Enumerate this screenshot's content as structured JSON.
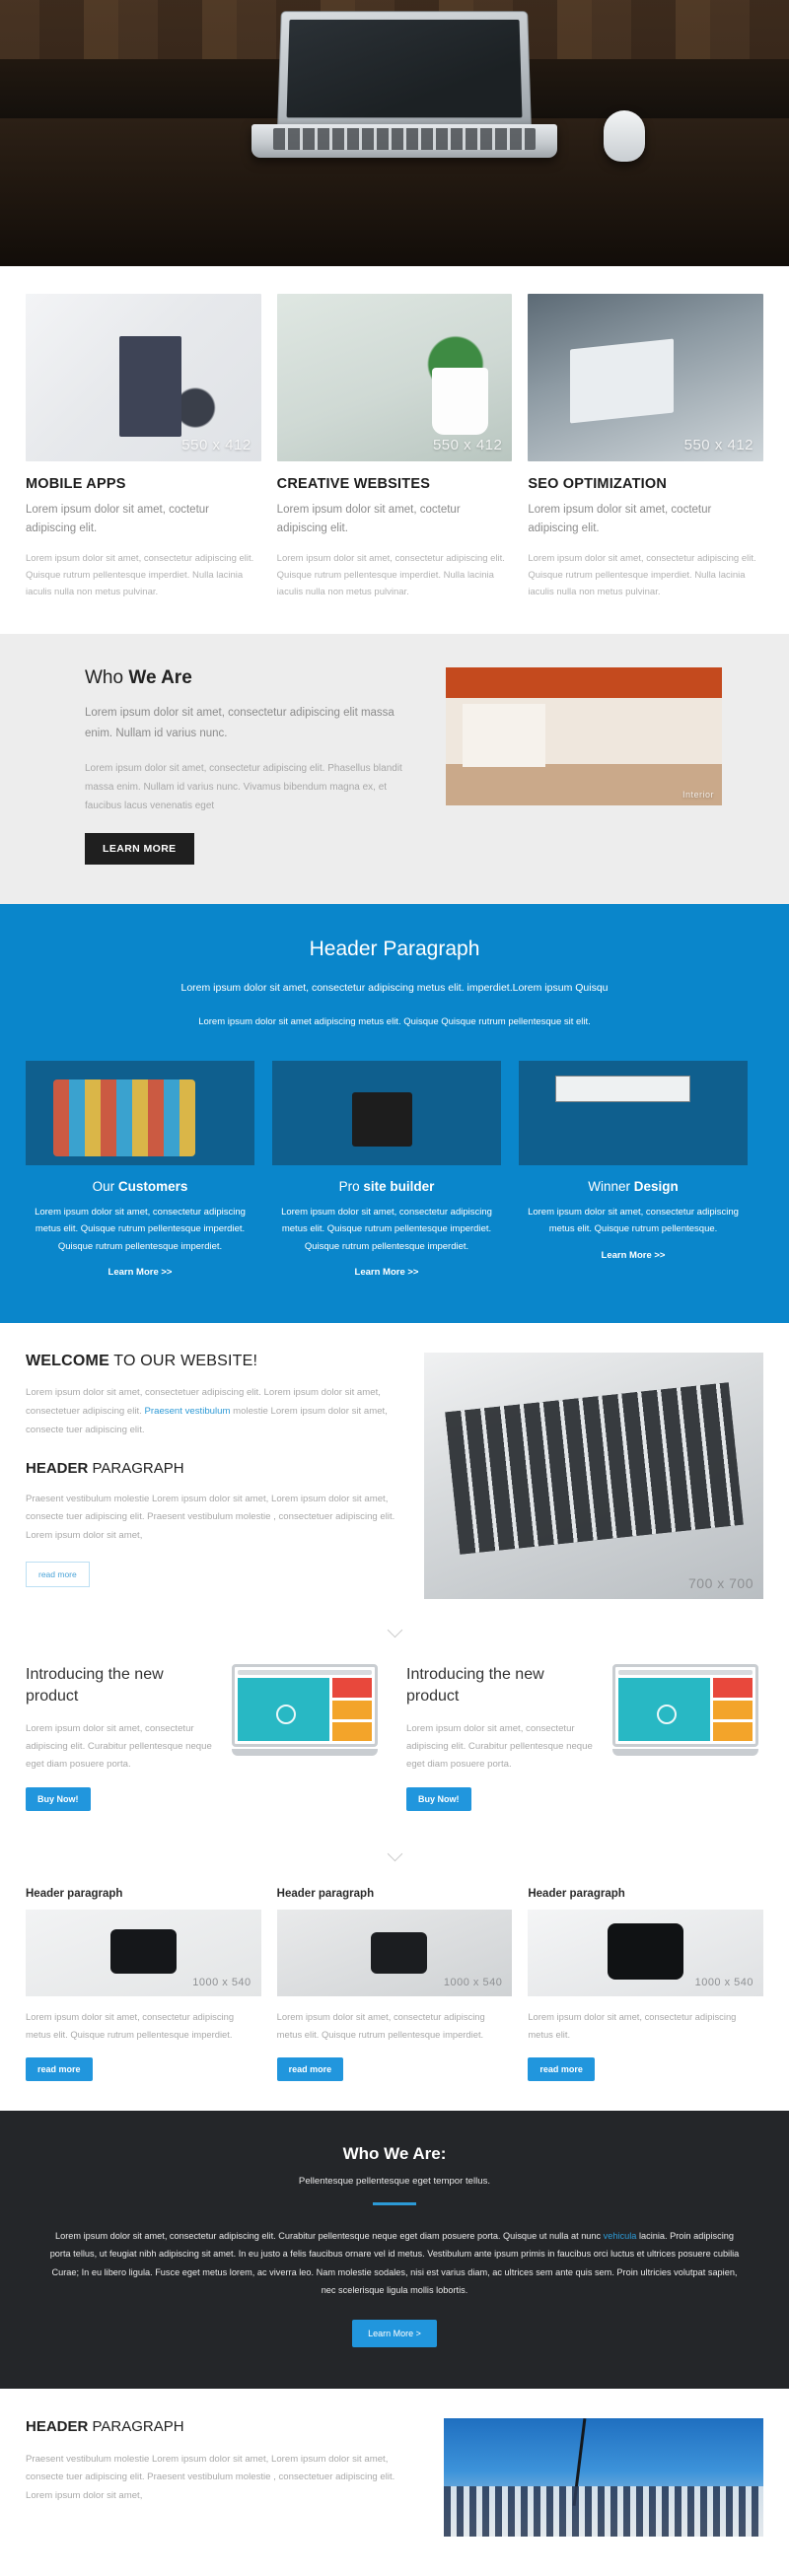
{
  "hero": {
    "alt": "laptop-on-desk-hero"
  },
  "services": {
    "items": [
      {
        "title": "MOBILE APPS",
        "lead": "Lorem ipsum dolor sit amet, coctetur adipiscing elit.",
        "body": "Lorem ipsum dolor sit amet, consectetur adipiscing elit. Quisque rutrum pellentesque imperdiet. Nulla lacinia iaculis nulla non metus pulvinar.",
        "placeholder": "550 x 412"
      },
      {
        "title": "CREATIVE WEBSITES",
        "lead": "Lorem ipsum dolor sit amet, coctetur adipiscing elit.",
        "body": "Lorem ipsum dolor sit amet, consectetur adipiscing elit. Quisque rutrum pellentesque imperdiet. Nulla lacinia iaculis nulla non metus pulvinar.",
        "placeholder": "550 x 412"
      },
      {
        "title": "SEO OPTIMIZATION",
        "lead": "Lorem ipsum dolor sit amet, coctetur adipiscing elit.",
        "body": "Lorem ipsum dolor sit amet, consectetur adipiscing elit. Quisque rutrum pellentesque imperdiet. Nulla lacinia iaculis nulla non metus pulvinar.",
        "placeholder": "550 x 412"
      }
    ]
  },
  "who_we_are": {
    "title_light": "Who ",
    "title_bold": "We Are",
    "lead": "Lorem ipsum dolor sit amet, consectetur adipiscing elit massa enim. Nullam id varius nunc.",
    "body": "Lorem ipsum dolor sit amet, consectetur adipiscing elit. Phasellus blandit massa enim. Nullam id varius nunc. Vivamus bibendum magna ex, et faucibus lacus venenatis eget",
    "button": "LEARN MORE",
    "image_label": "Interior"
  },
  "blue_section": {
    "heading": "Header Paragraph",
    "sub1": "Lorem ipsum dolor sit amet, consectetur adipiscing metus elit. imperdiet.Lorem ipsum Quisqu",
    "sub2": "Lorem ipsum dolor sit amet adipiscing metus elit. Quisque Quisque rutrum pellentesque sit elit.",
    "accent": "#0a86cb",
    "columns": [
      {
        "title_light": "Our ",
        "title_bold": "Customers",
        "body": "Lorem ipsum dolor sit amet, consectetur adipiscing metus elit. Quisque rutrum pellentesque imperdiet. Quisque rutrum pellentesque imperdiet.",
        "link": "Learn More >>"
      },
      {
        "title_light": "Pro ",
        "title_bold": "site builder",
        "body": "Lorem ipsum dolor sit amet, consectetur adipiscing metus elit. Quisque rutrum pellentesque imperdiet. Quisque rutrum pellentesque imperdiet.",
        "link": "Learn More >>"
      },
      {
        "title_light": "Winner ",
        "title_bold": "Design",
        "body": "Lorem ipsum dolor sit amet, consectetur adipiscing metus elit. Quisque rutrum pellentesque.",
        "link": "Learn More >>"
      }
    ]
  },
  "welcome": {
    "title_bold": "WELCOME",
    "title_light": " TO OUR WEBSITE!",
    "para1_a": "Lorem ipsum dolor sit amet, consectetuer adipiscing elit. Lorem ipsum dolor sit amet, consectetuer adipiscing elit. ",
    "para1_link": "Praesent vestibulum",
    "para1_b": " molestie Lorem ipsum dolor sit amet, consecte tuer adipiscing elit.",
    "sub_bold": "HEADER",
    "sub_light": " PARAGRAPH",
    "para2": "Praesent vestibulum molestie Lorem ipsum dolor sit amet, Lorem ipsum dolor sit amet, consecte tuer adipiscing elit. Praesent vestibulum molestie , consectetuer adipiscing elit. Lorem ipsum dolor sit amet,",
    "button": "read more",
    "image_placeholder": "700 x 700"
  },
  "intro_products": [
    {
      "title": "Introducing the new product",
      "body": "Lorem ipsum dolor sit amet, consectetur adipiscing elit. Curabitur pellentesque neque eget diam posuere porta.",
      "button": "Buy Now!"
    },
    {
      "title": "Introducing the new product",
      "body": "Lorem ipsum dolor sit amet, consectetur adipiscing elit. Curabitur pellentesque neque eget diam posuere porta.",
      "button": "Buy Now!"
    }
  ],
  "cards": [
    {
      "title": "Header paragraph",
      "placeholder": "1000 x 540",
      "body": "Lorem ipsum dolor sit amet, consectetur adipiscing metus elit. Quisque rutrum pellentesque imperdiet.",
      "button": "read more"
    },
    {
      "title": "Header paragraph",
      "placeholder": "1000 x 540",
      "body": "Lorem ipsum dolor sit amet, consectetur adipiscing metus elit. Quisque rutrum pellentesque imperdiet.",
      "button": "read more"
    },
    {
      "title": "Header paragraph",
      "placeholder": "1000 x 540",
      "body": "Lorem ipsum dolor sit amet, consectetur adipiscing metus elit.",
      "button": "read more"
    }
  ],
  "dark_section": {
    "heading": "Who We Are:",
    "subheading": "Pellentesque pellentesque eget tempor tellus.",
    "body_a": "Lorem ipsum dolor sit amet, consectetur adipiscing elit. Curabitur pellentesque neque eget diam posuere porta. Quisque ut nulla at nunc ",
    "body_link": "vehicula",
    "body_b": " lacinia. Proin adipiscing porta tellus, ut feugiat nibh adipiscing sit amet. In eu justo a felis faucibus ornare vel id metus. Vestibulum ante ipsum primis in faucibus orci luctus et ultrices posuere cubilia Curae; In eu libero ligula. Fusce eget metus lorem, ac viverra leo. Nam molestie sodales, nisi est varius diam, ac ultrices sem ante quis sem. Proin ultricies volutpat sapien, nec scelerisque ligula mollis lobortis.",
    "button": "Learn More >",
    "accent": "#2c9ad6",
    "background": "#242629"
  },
  "bottom_section": {
    "title_bold": "HEADER",
    "title_light": " PARAGRAPH",
    "body": "Praesent vestibulum molestie Lorem ipsum dolor sit amet, Lorem ipsum dolor sit amet, consecte tuer adipiscing elit. Praesent vestibulum molestie , consectetuer adipiscing elit.  Lorem ipsum dolor sit amet,"
  }
}
